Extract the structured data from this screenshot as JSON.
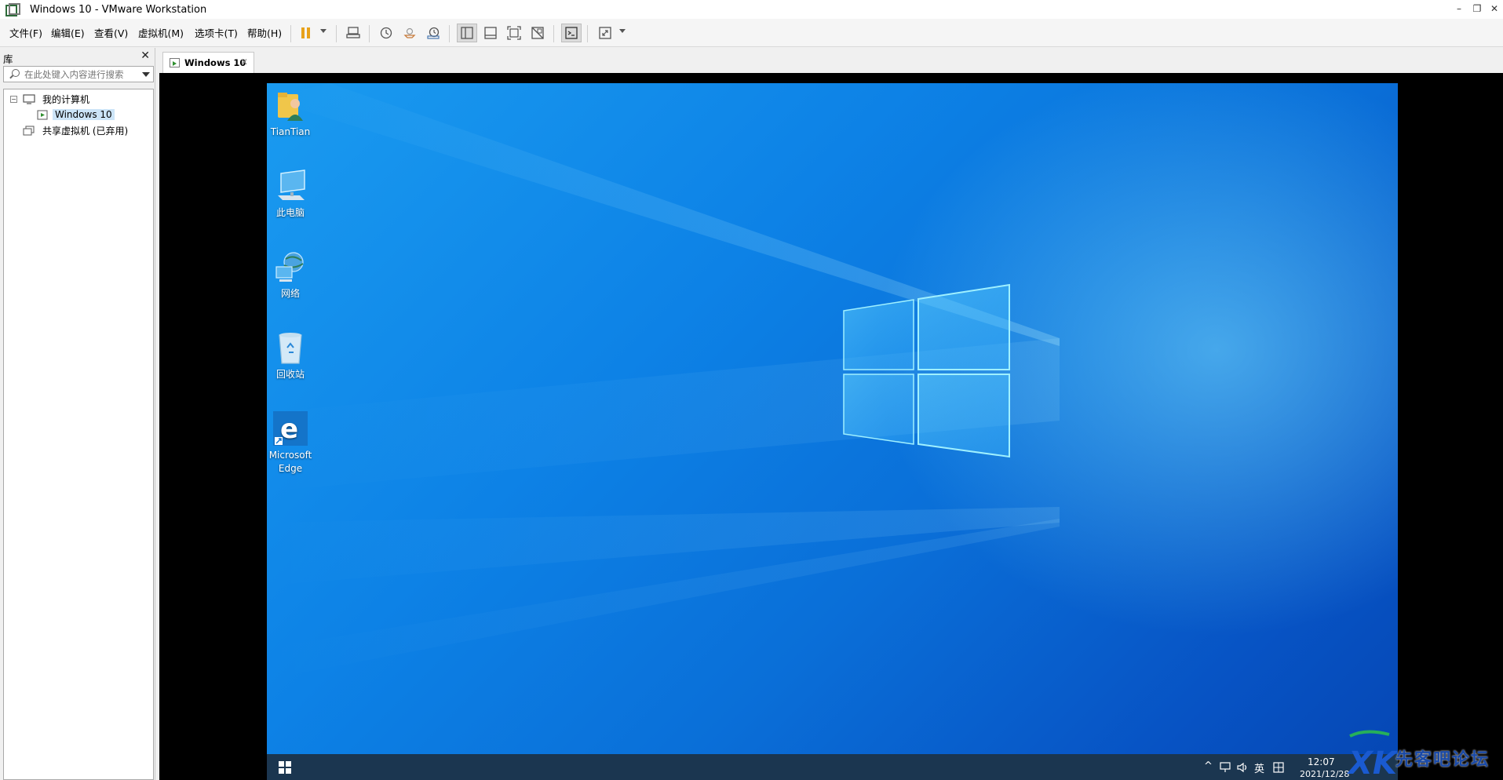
{
  "window": {
    "title": "Windows 10 - VMware Workstation",
    "minimize": "–",
    "restore": "❐",
    "close": "✕"
  },
  "menu": {
    "items": [
      "文件(F)",
      "编辑(E)",
      "查看(V)",
      "虚拟机(M)",
      "选项卡(T)",
      "帮助(H)"
    ]
  },
  "library": {
    "title": "库",
    "close": "✕",
    "search_placeholder": "在此处键入内容进行搜索",
    "tree": {
      "my_computer": "我的计算机",
      "vm": "Windows 10",
      "shared": "共享虚拟机 (已弃用)",
      "toggle": "−"
    }
  },
  "tab": {
    "label": "Windows 10",
    "close": "✕"
  },
  "desktop": {
    "icons": [
      {
        "label": "TianTian"
      },
      {
        "label": "此电脑"
      },
      {
        "label": "网络"
      },
      {
        "label": "回收站"
      },
      {
        "label": "Microsoft Edge"
      }
    ]
  },
  "taskbar": {
    "tray_chevron": "^",
    "ime": "英",
    "time": "12:07",
    "date": "2021/12/28"
  },
  "watermark": {
    "text": "先客吧论坛",
    "logo": "XK"
  },
  "colors": {
    "desktop_blue": "#0d82e6",
    "taskbar": "#1b3650",
    "selection": "#cce4f7",
    "pause_orange": "#e8a21a"
  }
}
